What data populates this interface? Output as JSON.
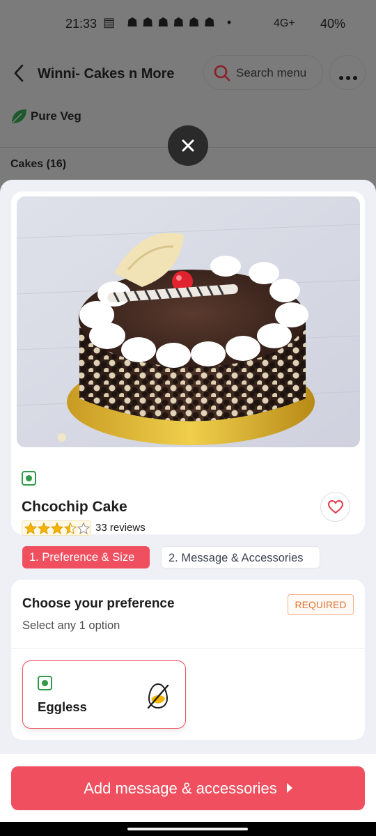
{
  "status_bar": {
    "time": "21:33",
    "network": "4G+",
    "battery": "40%"
  },
  "header": {
    "title": "Winni- Cakes n More",
    "search_label": "Search menu"
  },
  "restaurant": {
    "pure_veg_label": "Pure Veg",
    "section_heading": "Cakes (16)"
  },
  "product": {
    "name": "Chcochip Cake",
    "rating": 3.5,
    "rating_max": 5,
    "reviews": "33 reviews"
  },
  "steps": {
    "step1": "1. Preference & Size",
    "step2": "2. Message & Accessories"
  },
  "preference": {
    "title": "Choose your preference",
    "subtitle": "Select any 1 option",
    "badge": "REQUIRED",
    "option_label": "Eggless"
  },
  "cta": {
    "label": "Add message & accessories"
  },
  "colors": {
    "accent": "#ef4f5f",
    "veg_green": "#2f9a47",
    "required_orange": "#e27332"
  }
}
